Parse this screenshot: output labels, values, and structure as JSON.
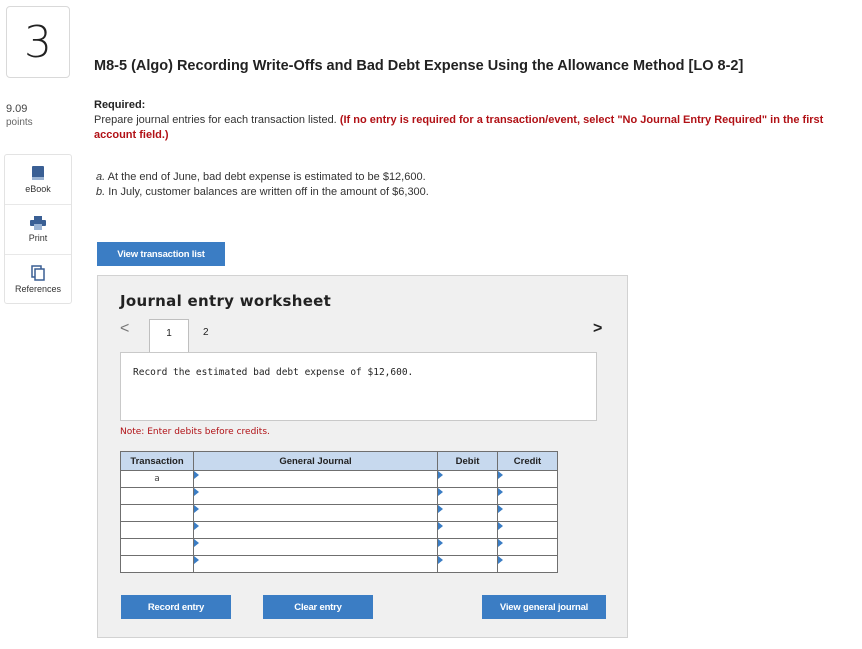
{
  "question": {
    "number": "3",
    "points_value": "9.09",
    "points_label": "points"
  },
  "tools": {
    "ebook": "eBook",
    "print": "Print",
    "references": "References"
  },
  "title": "M8-5 (Algo) Recording Write-Offs and Bad Debt Expense Using the Allowance Method [LO 8-2]",
  "required": {
    "heading": "Required:",
    "text": "Prepare journal entries for each transaction listed. ",
    "red_note": "(If no entry is required for a transaction/event, select \"No Journal Entry Required\" in the first account field.)"
  },
  "transactions": [
    {
      "letter": "a.",
      "text": " At the end of June, bad debt expense is estimated to be $12,600."
    },
    {
      "letter": "b.",
      "text": " In July, customer balances are written off in the amount of $6,300."
    }
  ],
  "buttons": {
    "view_transaction_list": "View transaction list",
    "record_entry": "Record entry",
    "clear_entry": "Clear entry",
    "view_general_journal": "View general journal"
  },
  "worksheet": {
    "title": "Journal entry worksheet",
    "tabs": [
      "1",
      "2"
    ],
    "nav_prev": "<",
    "nav_next": ">",
    "description": "Record the estimated bad debt expense of $12,600.",
    "note": "Note: Enter debits before credits."
  },
  "journal": {
    "headers": {
      "transaction": "Transaction",
      "general_journal": "General Journal",
      "debit": "Debit",
      "credit": "Credit"
    },
    "rows": [
      {
        "transaction": "a"
      },
      {
        "transaction": ""
      },
      {
        "transaction": ""
      },
      {
        "transaction": ""
      },
      {
        "transaction": ""
      },
      {
        "transaction": ""
      }
    ]
  },
  "colors": {
    "accent": "#3b7dc4",
    "header_bg": "#c7d9ee",
    "required_red": "#b11116"
  }
}
